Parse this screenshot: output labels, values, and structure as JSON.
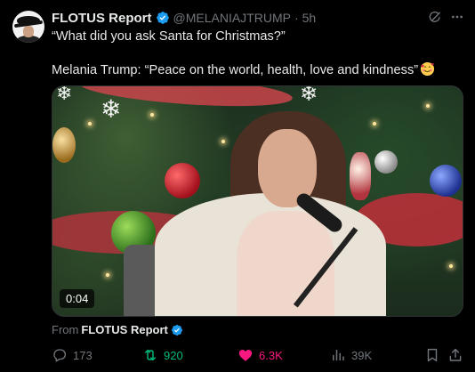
{
  "post": {
    "author_name": "FLOTUS Report",
    "author_handle": "@MELANIAJTRUMP",
    "separator": "·",
    "time": "5h",
    "line1": "“What did you ask Santa for Christmas?”",
    "line2": "Melania Trump: “Peace on the world, health, love and kindness”",
    "emoji": "smiling-face-with-hearts-emoji"
  },
  "media": {
    "duration": "0:04"
  },
  "source": {
    "prefix": "From",
    "name": "FLOTUS Report"
  },
  "actions": {
    "replies": "173",
    "reposts": "920",
    "likes": "6.3K",
    "views": "39K"
  },
  "colors": {
    "background": "#000000",
    "text": "#e7e9ea",
    "muted": "#71767b",
    "verified": "#1d9bf0",
    "repost": "#00ba7c",
    "like": "#f91880"
  }
}
